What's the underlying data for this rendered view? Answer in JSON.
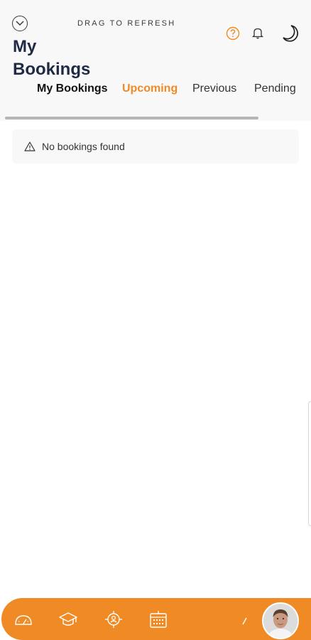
{
  "header": {
    "drag_to_refresh": "DRAG TO REFRESH",
    "title_line1": "My",
    "title_line2": "Bookings"
  },
  "tabs": [
    {
      "label": "My Bookings",
      "state": "default"
    },
    {
      "label": "Upcoming",
      "state": "active"
    },
    {
      "label": "Previous",
      "state": "default"
    },
    {
      "label": "Pending",
      "state": "default"
    }
  ],
  "empty_state": {
    "message": "No bookings found",
    "icon": "warning-icon"
  },
  "bottom_nav": {
    "items": [
      "dashboard-icon",
      "graduation-cap-icon",
      "target-user-icon",
      "calendar-icon",
      "edit-icon"
    ],
    "avatar": "user-avatar"
  },
  "colors": {
    "accent": "#f08a24",
    "title": "#1f2a44",
    "header_bg": "#f8f8f8"
  }
}
